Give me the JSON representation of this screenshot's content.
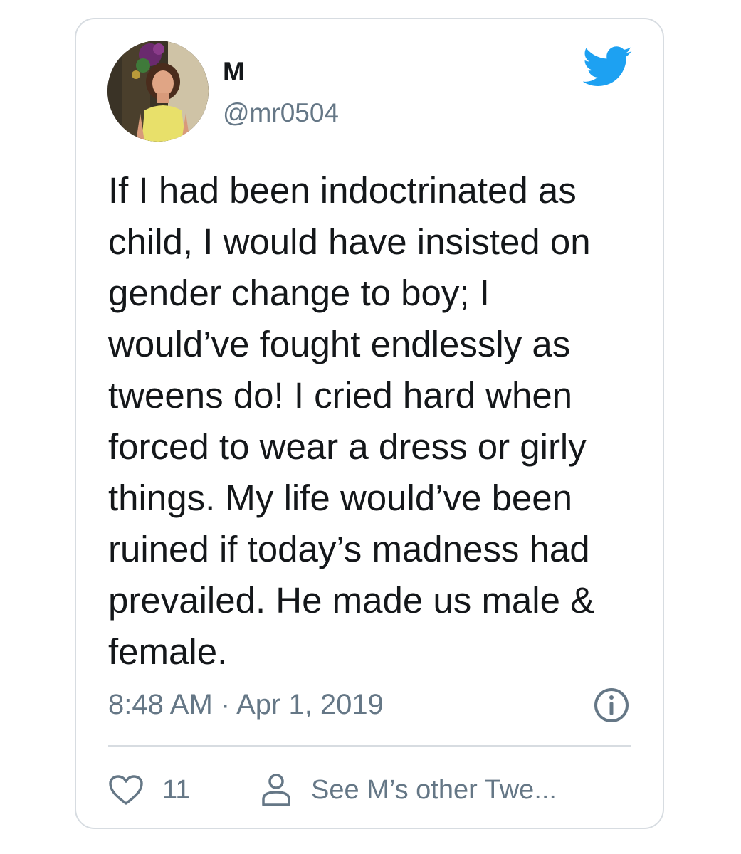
{
  "tweet": {
    "display_name": "M",
    "handle": "@mr0504",
    "text": "If I had been indoctrinated as\nchild, I would have insisted on\ngender change to boy; I\nwould’ve fought endlessly as\ntweens do! I cried hard when\nforced to wear a dress or girly\nthings. My life would’ve been\nruined if today’s madness had\nprevailed. He made us male &\nfemale.",
    "timestamp": "8:48 AM · Apr 1, 2019",
    "like_count": "11",
    "profile_link_label": "See M’s other Twe..."
  },
  "icons": {
    "brand": "twitter-bird-icon",
    "info": "info-icon",
    "like": "heart-icon",
    "profile": "person-icon"
  },
  "colors": {
    "brand_blue": "#1da1f2",
    "text": "#14171a",
    "secondary_text": "#657786",
    "border": "#d7dce1"
  }
}
